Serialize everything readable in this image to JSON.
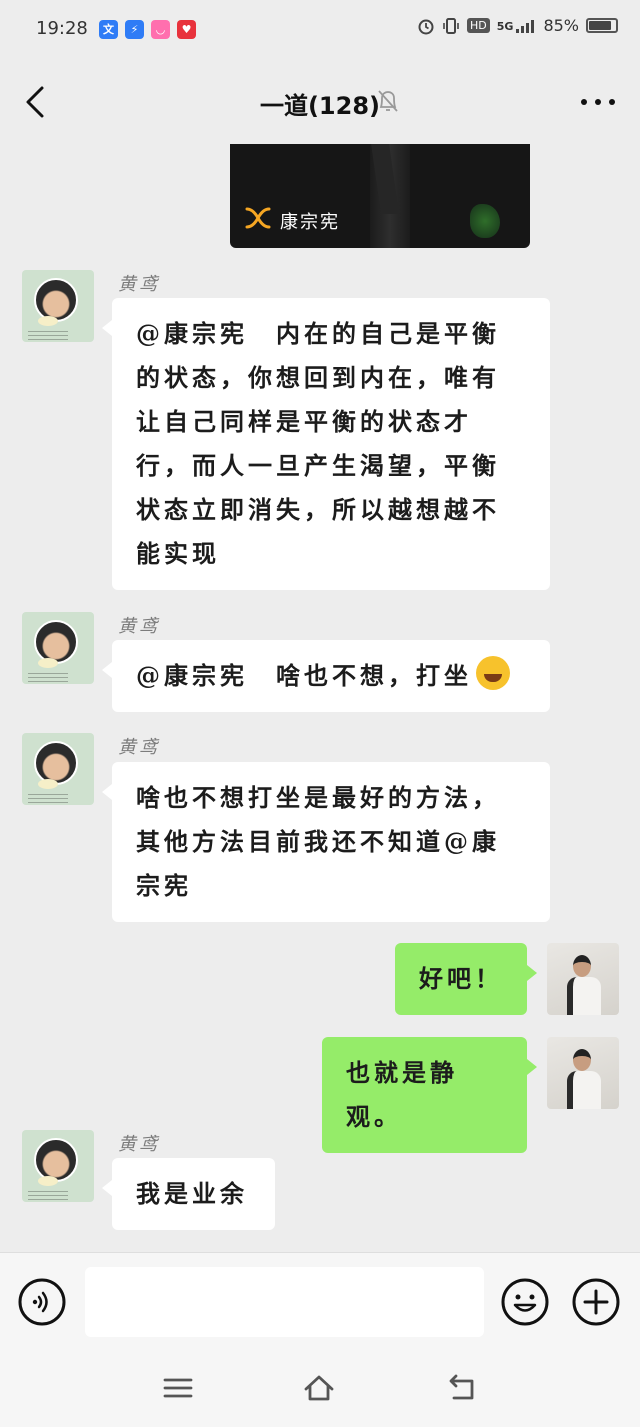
{
  "status_bar": {
    "time": "19:28",
    "network": "5G",
    "hd": "HD",
    "battery": "85%"
  },
  "header": {
    "title": "一道(128)"
  },
  "video_card": {
    "channel_name": "康宗宪"
  },
  "messages": [
    {
      "sender": "黄鸢",
      "text": "@康宗宪　内在的自己是平衡的状态，你想回到内在，唯有让自己同样是平衡的状态才行，而人一旦产生渴望，平衡状态立即消失，所以越想越不能实现"
    },
    {
      "sender": "黄鸢",
      "text": "@康宗宪　啥也不想，打坐",
      "emoji": "laugh-cry-emoji"
    },
    {
      "sender": "黄鸢",
      "text": "啥也不想打坐是最好的方法，其他方法目前我还不知道@康宗宪"
    },
    {
      "text": "好吧！"
    },
    {
      "text": "也就是静观。"
    },
    {
      "sender": "黄鸢",
      "text": "我是业余"
    }
  ],
  "composer": {
    "input_value": ""
  },
  "colors": {
    "background": "#ededed",
    "outgoing_bubble": "#95ec69",
    "incoming_bubble": "#ffffff"
  }
}
